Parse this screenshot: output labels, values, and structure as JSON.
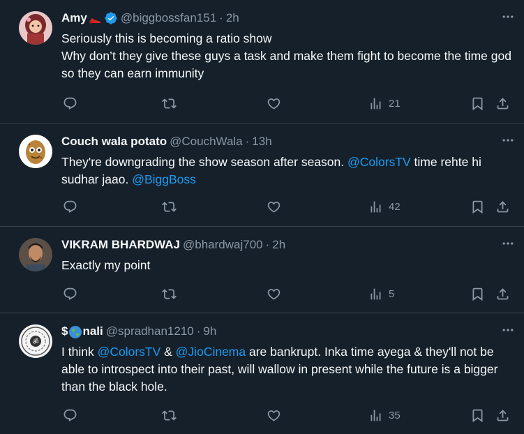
{
  "tweets": [
    {
      "name": "Amy",
      "name_emoji": "high-heel-icon",
      "verified": true,
      "handle": "@biggbossfan151",
      "time": "2h",
      "lines": [
        "Seriously this is becoming a ratio show",
        "Why don’t they give these guys a task and make them fight to become the time god so they can earn immunity"
      ],
      "views": "21"
    },
    {
      "name": "Couch wala potato",
      "handle": "@CouchWala",
      "time": "13h",
      "text_a": "They're downgrading the show season after season. ",
      "mention_1": "@ColorsTV",
      "text_b": " time rehte hi sudhar jaao. ",
      "mention_2": "@BiggBoss",
      "views": "42"
    },
    {
      "name": "VIKRAM BHARDWAJ",
      "handle": "@bhardwaj700",
      "time": "2h",
      "text": "Exactly my point",
      "views": "5"
    },
    {
      "name_prefix": "$",
      "name_emoji": "globe-icon",
      "name_suffix": "nali",
      "handle": "@spradhan1210",
      "time": "9h",
      "text_a": "I think ",
      "mention_1": "@ColorsTV",
      "text_b": " & ",
      "mention_2": "@JioCinema",
      "text_c": " are bankrupt. Inka time ayega & they'll not be able to introspect into their past, will wallow in present while the future is a bigger than the black hole.",
      "views": "35"
    }
  ],
  "separator": "·",
  "colors": {
    "background": "#15202b",
    "text": "#f7f9f9",
    "muted": "#8b98a5",
    "link": "#1d9bf0",
    "divider": "#38444d",
    "verified": "#1d9bf0"
  }
}
